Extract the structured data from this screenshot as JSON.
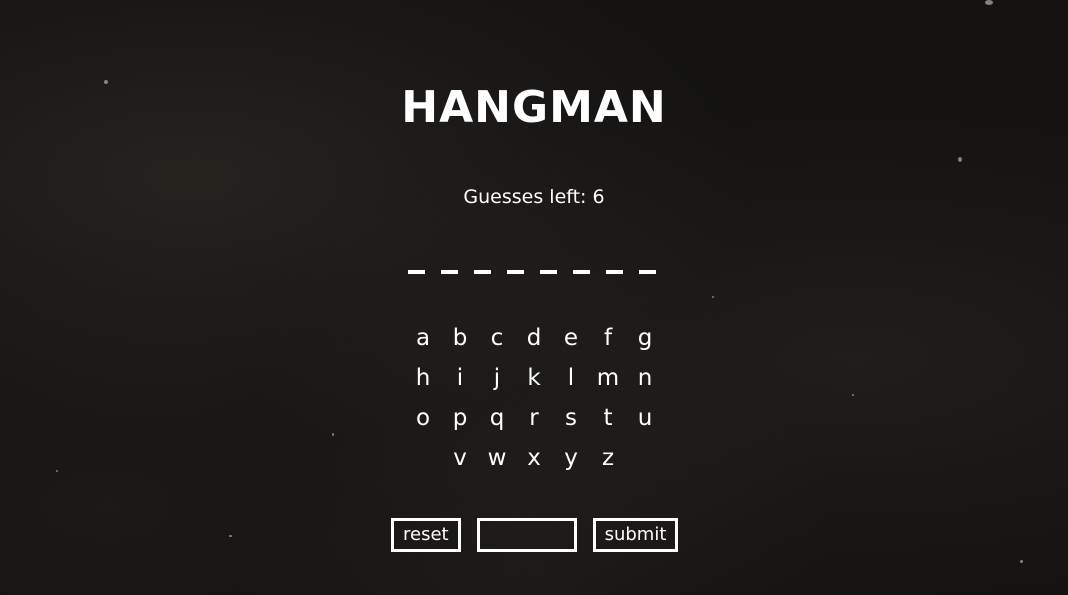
{
  "game": {
    "title": "HANGMAN",
    "guesses_left_text": "Guesses left: 6",
    "word_blanks": [
      "_",
      "_",
      "_",
      "_",
      "_",
      "_",
      "_",
      "_"
    ]
  },
  "keyboard": {
    "rows": [
      [
        "a",
        "b",
        "c",
        "d",
        "e",
        "f",
        "g"
      ],
      [
        "h",
        "i",
        "j",
        "k",
        "l",
        "m",
        "n"
      ],
      [
        "o",
        "p",
        "q",
        "r",
        "s",
        "t",
        "u"
      ],
      [
        "v",
        "w",
        "x",
        "y",
        "z"
      ]
    ]
  },
  "controls": {
    "reset_label": "reset",
    "guess_value": "",
    "submit_label": "submit"
  },
  "colors": {
    "background": "#141312",
    "foreground": "#ffffff"
  }
}
